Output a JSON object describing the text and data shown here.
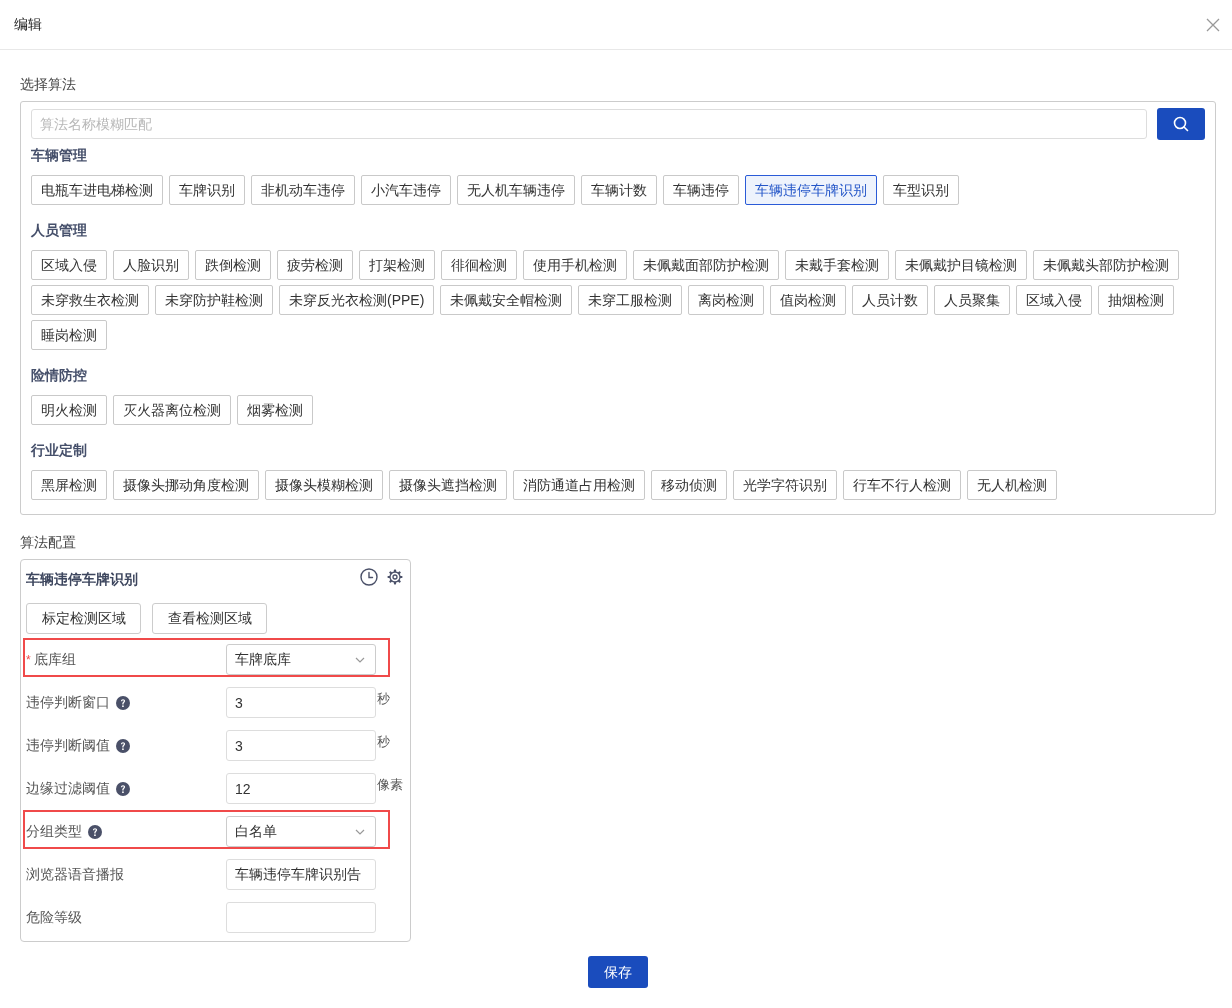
{
  "dialog": {
    "title": "编辑"
  },
  "algorithm_section": {
    "label": "选择算法",
    "search": {
      "placeholder": "算法名称模糊匹配"
    },
    "categories": [
      {
        "name": "车辆管理",
        "algorithms": [
          {
            "label": "电瓶车进电梯检测",
            "selected": false
          },
          {
            "label": "车牌识别",
            "selected": false
          },
          {
            "label": "非机动车违停",
            "selected": false
          },
          {
            "label": "小汽车违停",
            "selected": false
          },
          {
            "label": "无人机车辆违停",
            "selected": false
          },
          {
            "label": "车辆计数",
            "selected": false
          },
          {
            "label": "车辆违停",
            "selected": false
          },
          {
            "label": "车辆违停车牌识别",
            "selected": true
          },
          {
            "label": "车型识别",
            "selected": false
          }
        ]
      },
      {
        "name": "人员管理",
        "algorithms": [
          {
            "label": "区域入侵",
            "selected": false
          },
          {
            "label": "人脸识别",
            "selected": false
          },
          {
            "label": "跌倒检测",
            "selected": false
          },
          {
            "label": "疲劳检测",
            "selected": false
          },
          {
            "label": "打架检测",
            "selected": false
          },
          {
            "label": "徘徊检测",
            "selected": false
          },
          {
            "label": "使用手机检测",
            "selected": false
          },
          {
            "label": "未佩戴面部防护检测",
            "selected": false
          },
          {
            "label": "未戴手套检测",
            "selected": false
          },
          {
            "label": "未佩戴护目镜检测",
            "selected": false
          },
          {
            "label": "未佩戴头部防护检测",
            "selected": false
          },
          {
            "label": "未穿救生衣检测",
            "selected": false
          },
          {
            "label": "未穿防护鞋检测",
            "selected": false
          },
          {
            "label": "未穿反光衣检测(PPE)",
            "selected": false
          },
          {
            "label": "未佩戴安全帽检测",
            "selected": false
          },
          {
            "label": "未穿工服检测",
            "selected": false
          },
          {
            "label": "离岗检测",
            "selected": false
          },
          {
            "label": "值岗检测",
            "selected": false
          },
          {
            "label": "人员计数",
            "selected": false
          },
          {
            "label": "人员聚集",
            "selected": false
          },
          {
            "label": "区域入侵",
            "selected": false
          },
          {
            "label": "抽烟检测",
            "selected": false
          },
          {
            "label": "睡岗检测",
            "selected": false
          }
        ]
      },
      {
        "name": "险情防控",
        "algorithms": [
          {
            "label": "明火检测",
            "selected": false
          },
          {
            "label": "灭火器离位检测",
            "selected": false
          },
          {
            "label": "烟雾检测",
            "selected": false
          }
        ]
      },
      {
        "name": "行业定制",
        "algorithms": [
          {
            "label": "黑屏检测",
            "selected": false
          },
          {
            "label": "摄像头挪动角度检测",
            "selected": false
          },
          {
            "label": "摄像头模糊检测",
            "selected": false
          },
          {
            "label": "摄像头遮挡检测",
            "selected": false
          },
          {
            "label": "消防通道占用检测",
            "selected": false
          },
          {
            "label": "移动侦测",
            "selected": false
          },
          {
            "label": "光学字符识别",
            "selected": false
          },
          {
            "label": "行车不行人检测",
            "selected": false
          },
          {
            "label": "无人机检测",
            "selected": false
          }
        ]
      }
    ]
  },
  "config_section": {
    "label": "算法配置",
    "card": {
      "title": "车辆违停车牌识别",
      "buttons": [
        "标定检测区域",
        "查看检测区域"
      ],
      "fields": [
        {
          "kind": "select",
          "required_mark": "*",
          "label": "底库组",
          "help": false,
          "value": "车牌底库",
          "highlighted": true
        },
        {
          "kind": "input",
          "label": "违停判断窗口",
          "help": true,
          "value": "3",
          "unit": "秒",
          "highlighted": false
        },
        {
          "kind": "input",
          "label": "违停判断阈值",
          "help": true,
          "value": "3",
          "unit": "秒",
          "highlighted": false
        },
        {
          "kind": "input",
          "label": "边缘过滤阈值",
          "help": true,
          "value": "12",
          "unit": "像素",
          "highlighted": false
        },
        {
          "kind": "select",
          "label": "分组类型",
          "help": true,
          "value": "白名单",
          "highlighted": true
        },
        {
          "kind": "input",
          "label": "浏览器语音播报",
          "help": false,
          "value": "车辆违停车牌识别告",
          "highlighted": false
        },
        {
          "kind": "input",
          "label": "危险等级",
          "help": false,
          "highlighted": false
        }
      ]
    }
  },
  "save_button": "保存"
}
